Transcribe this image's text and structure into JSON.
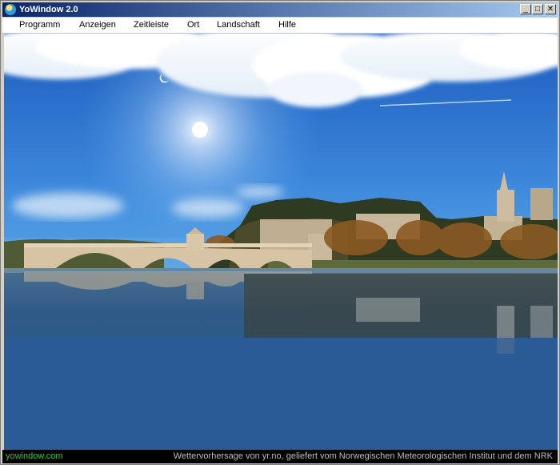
{
  "window": {
    "title": "YoWindow 2.0"
  },
  "title_buttons": {
    "minimize": "_",
    "maximize": "□",
    "close": "✕"
  },
  "menu": {
    "items": [
      "Programm",
      "Anzeigen",
      "Zeitleiste",
      "Ort",
      "Landschaft",
      "Hilfe"
    ]
  },
  "status": {
    "left": "yowindow.com",
    "right": "Wettervorhersage von yr.no, geliefert vom Norwegischen Meteorologischen Institut und dem NRK"
  },
  "colors": {
    "sky_top": "#1f5fc0",
    "sky_bottom": "#4fa0e8",
    "water": "#274f80",
    "title_bar": "#0a246a",
    "status_link": "#27c93f"
  }
}
